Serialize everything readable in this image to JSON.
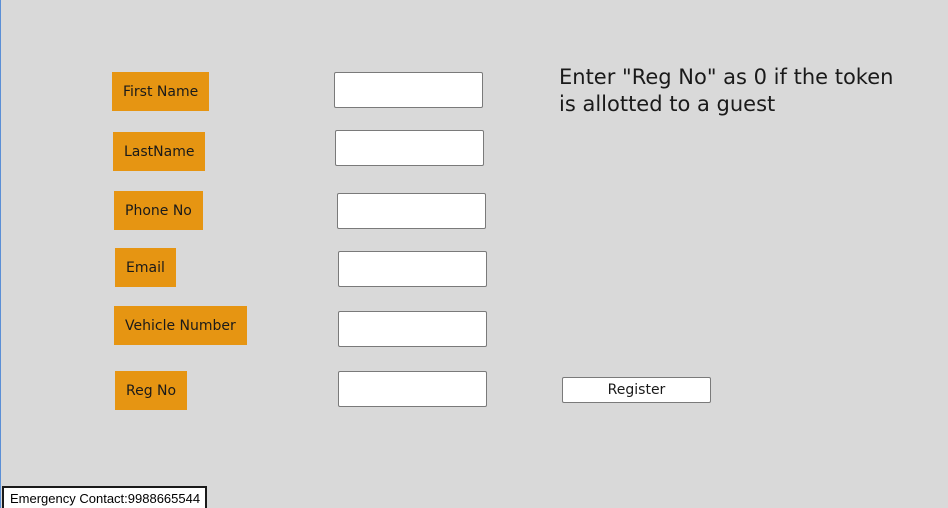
{
  "form": {
    "first_name_label": "First Name",
    "last_name_label": "LastName",
    "phone_label": "Phone No",
    "email_label": "Email",
    "vehicle_label": "Vehicle Number",
    "reg_no_label": "Reg No",
    "first_name_value": "",
    "last_name_value": "",
    "phone_value": "",
    "email_value": "",
    "vehicle_value": "",
    "reg_no_value": ""
  },
  "hint": {
    "text": "Enter \"Reg No\" as 0 if the token is allotted to a guest"
  },
  "actions": {
    "register_label": "Register"
  },
  "footer": {
    "emergency_contact": "Emergency Contact:9988665544"
  },
  "colors": {
    "background": "#d9d9d9",
    "label_bg": "#e69512"
  }
}
